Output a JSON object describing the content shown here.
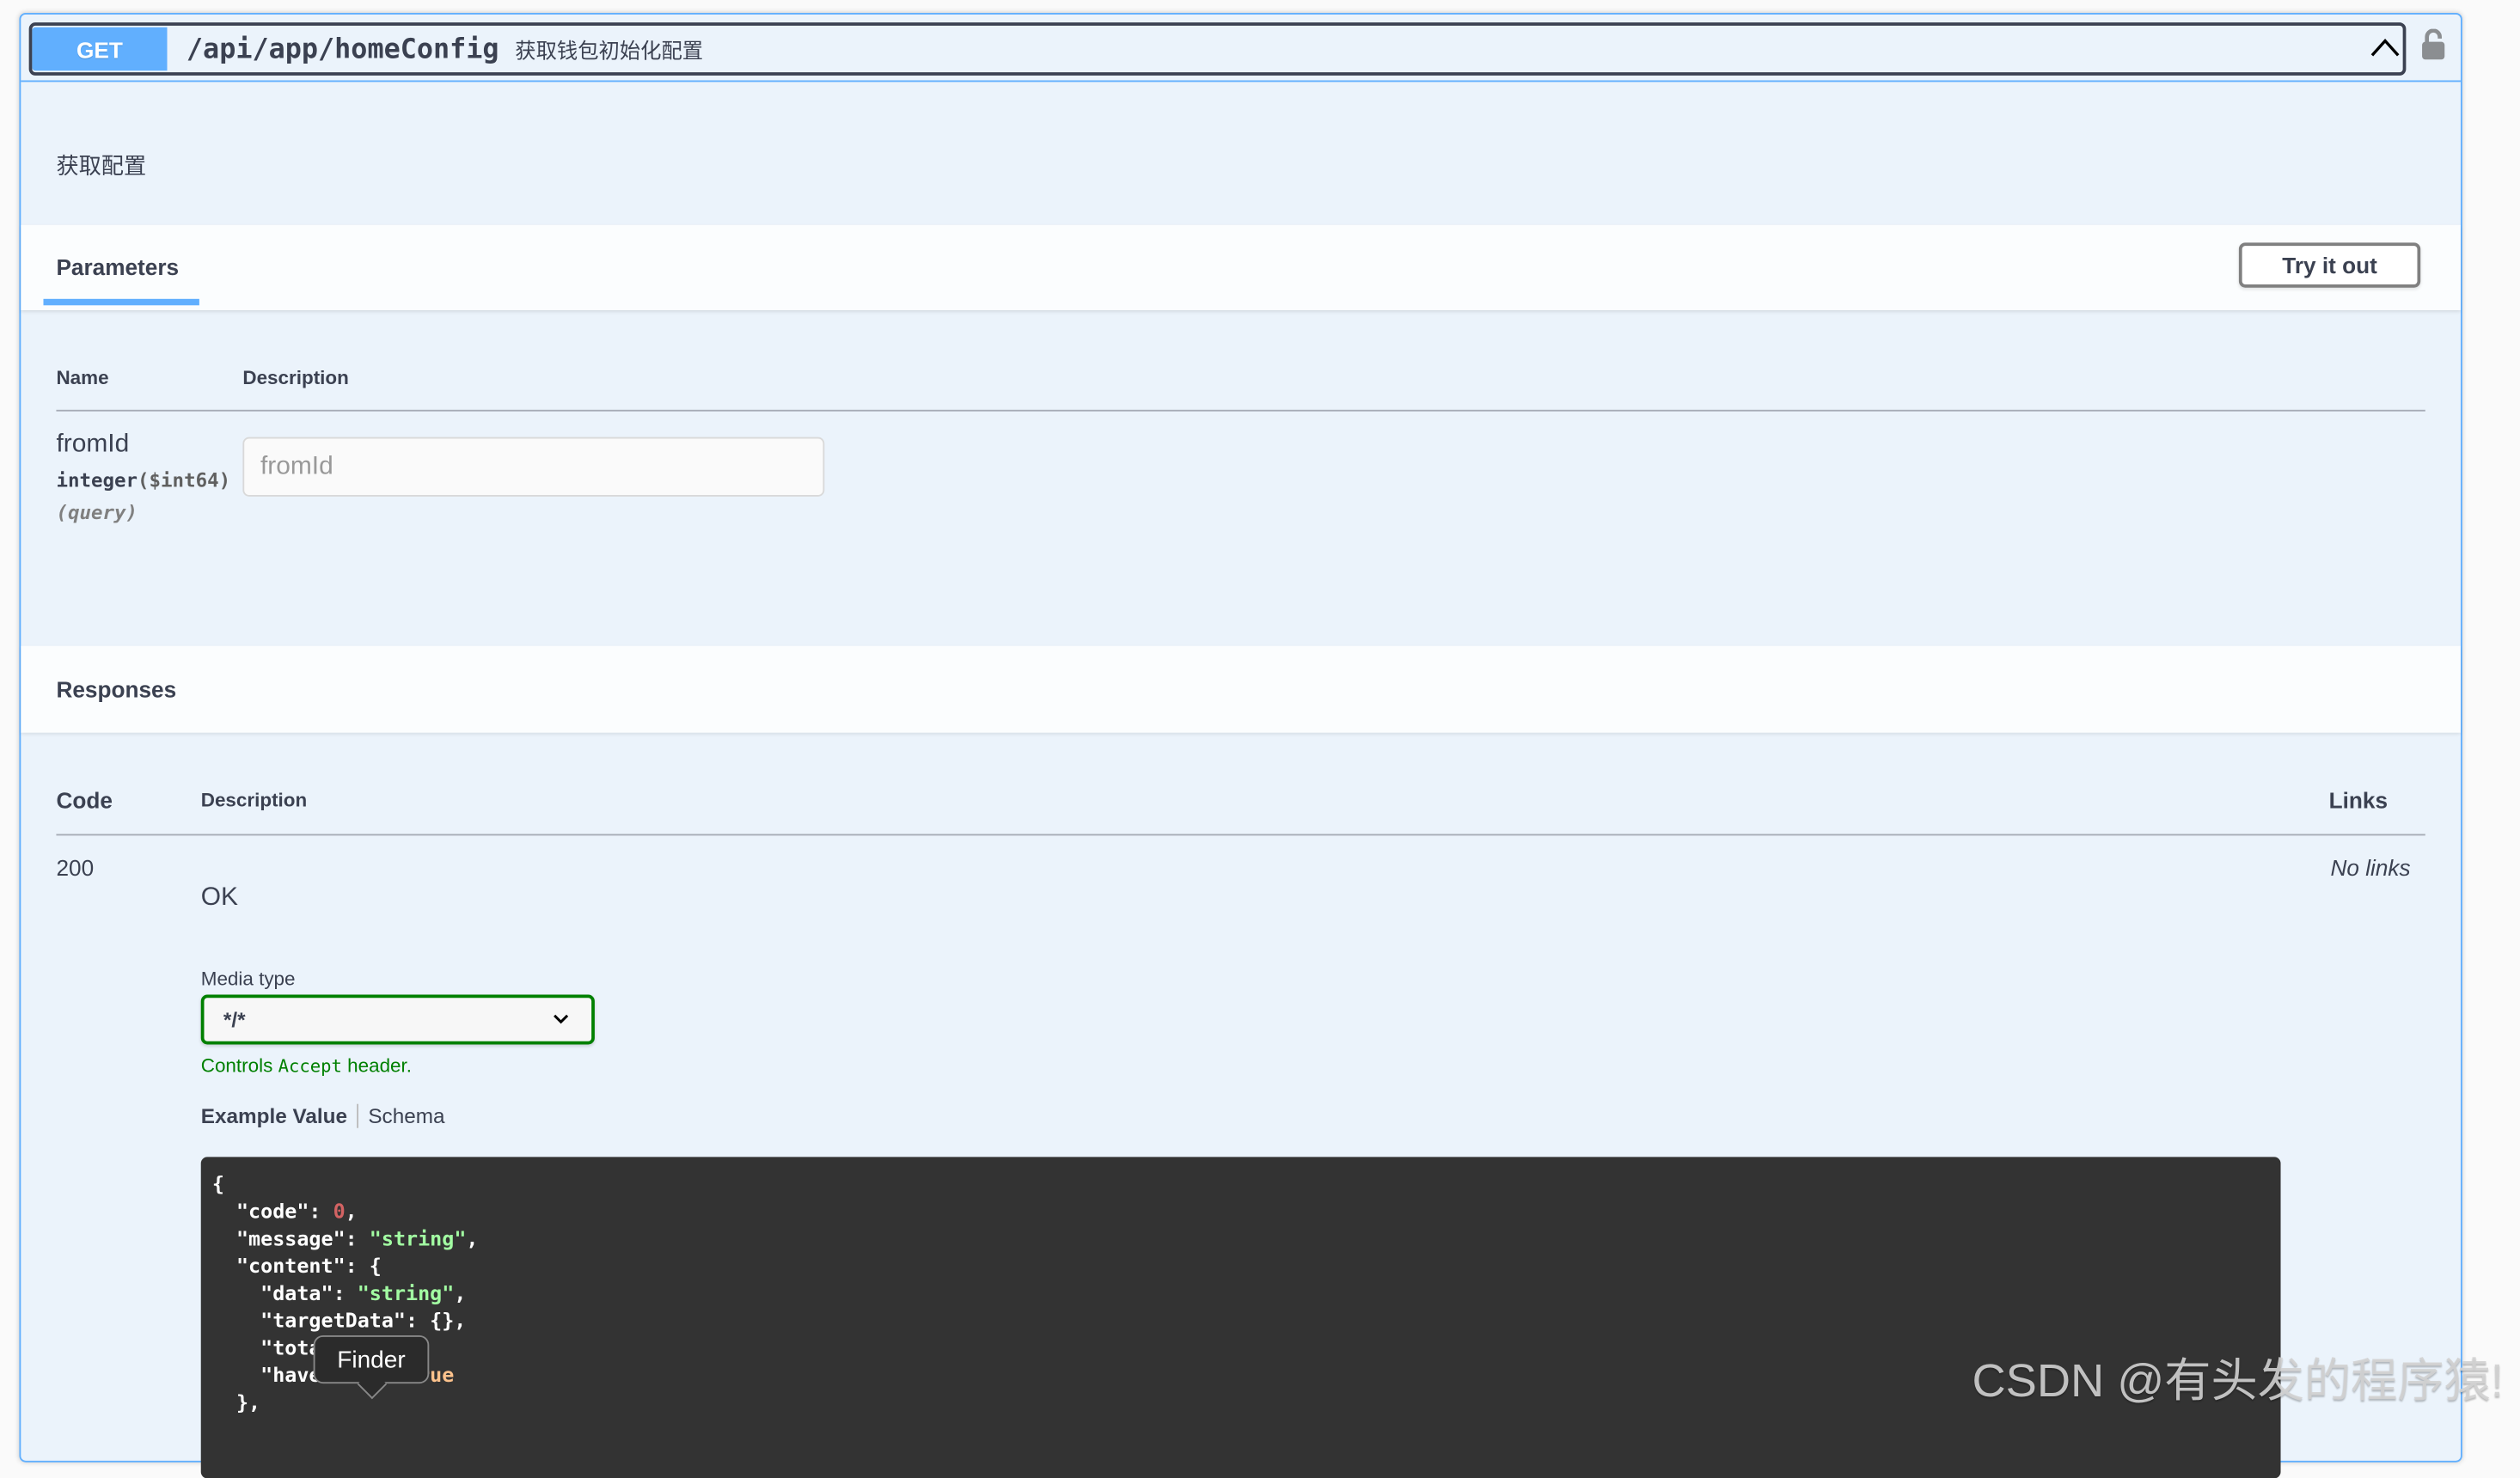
{
  "operation": {
    "method": "GET",
    "path": "/api/app/homeConfig",
    "summary": "获取钱包初始化配置",
    "description": "获取配置",
    "method_color": "#61affe"
  },
  "parameters": {
    "tab_label": "Parameters",
    "try_it_out_label": "Try it out",
    "columns": {
      "name": "Name",
      "description": "Description"
    },
    "items": [
      {
        "name": "fromId",
        "type": "integer",
        "format": "($int64)",
        "in": "(query)",
        "placeholder": "fromId",
        "value": ""
      }
    ]
  },
  "responses": {
    "title": "Responses",
    "columns": {
      "code": "Code",
      "description": "Description",
      "links": "Links"
    },
    "items": [
      {
        "code": "200",
        "description": "OK",
        "links": "No links",
        "media_type_label": "Media type",
        "media_type_value": "*/*",
        "accept_hint_prefix": "Controls ",
        "accept_hint_code": "Accept",
        "accept_hint_suffix": " header.",
        "example_tabs": [
          "Example Value",
          "Schema"
        ],
        "example_lines": [
          "{",
          "  \"code\": 0,",
          "  \"message\": \"string\",",
          "  \"content\": {",
          "    \"data\": \"string\",",
          "    \"targetData\": {},",
          "    \"total\": 0,",
          "    \"haveMore\": true",
          "  },"
        ]
      }
    ]
  },
  "tooltip": "Finder",
  "watermark": "CSDN @有头发的程序猿!"
}
